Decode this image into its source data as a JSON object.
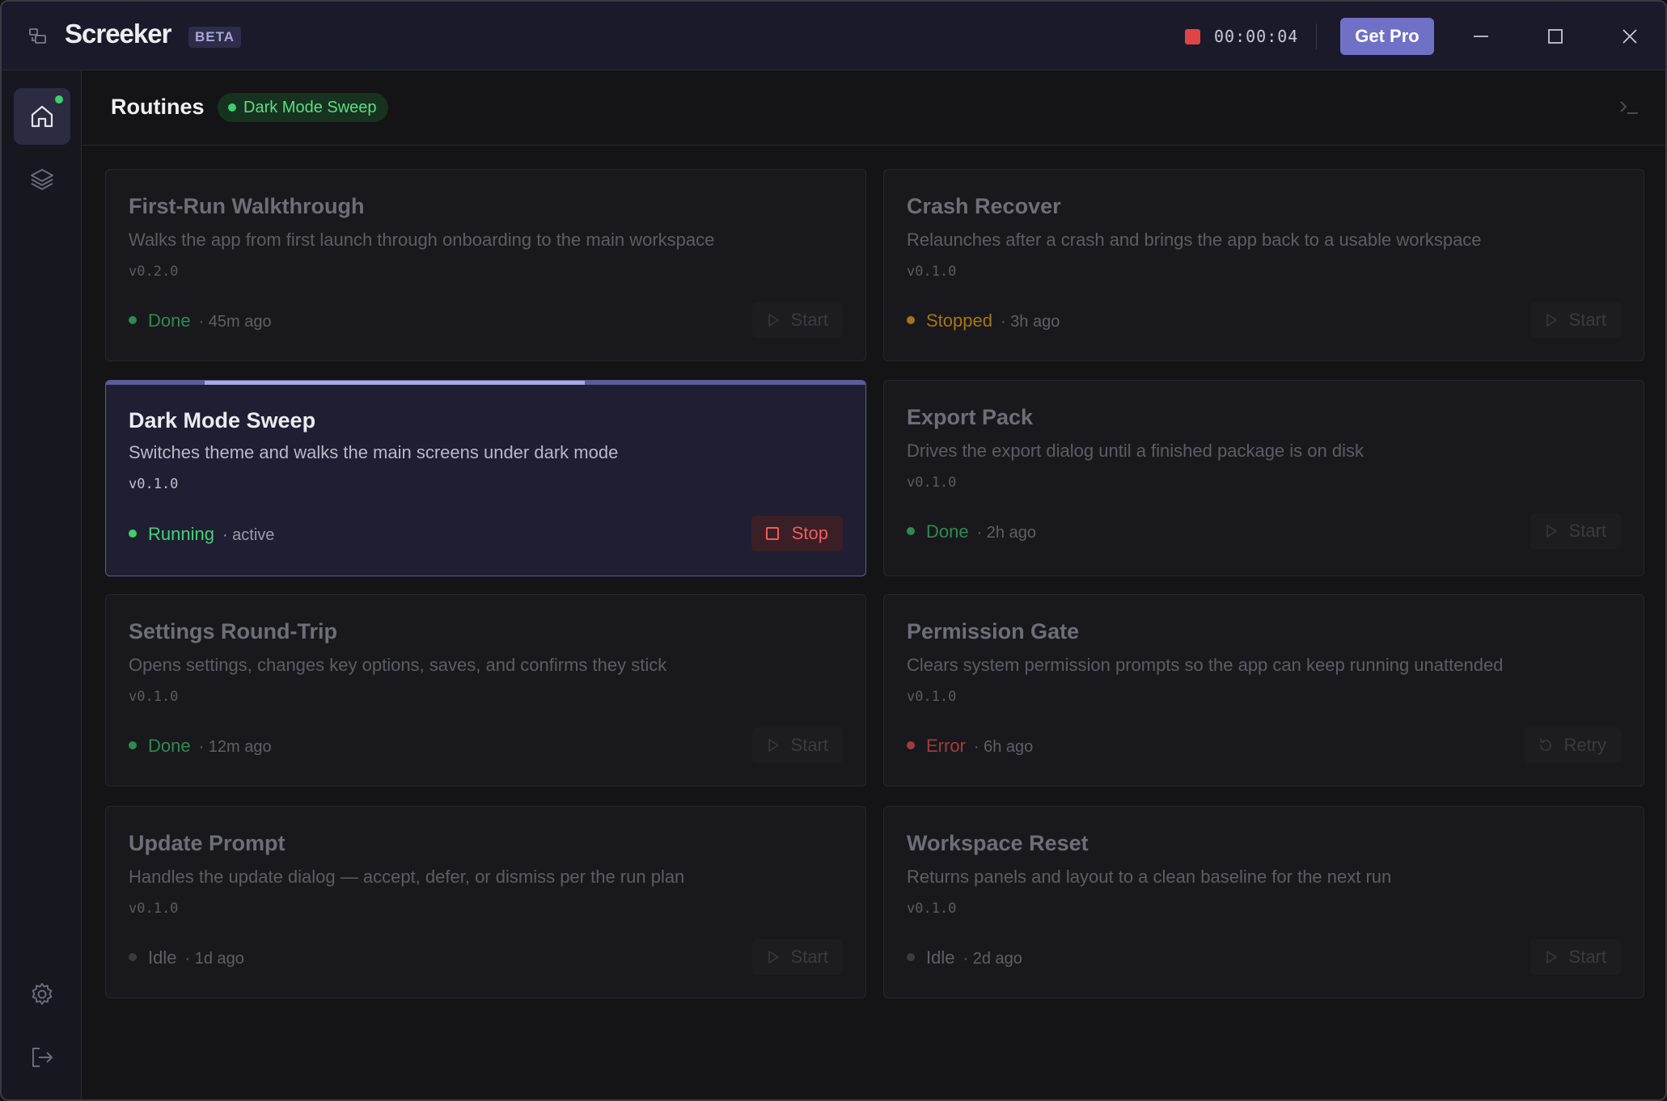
{
  "titlebar": {
    "app_name": "Screeker",
    "badge": "BETA",
    "timer": "00:00:04",
    "get_pro_label": "Get Pro",
    "record_color": "#e04545"
  },
  "sidebar": {
    "items": [
      {
        "name": "home",
        "icon": "home-icon",
        "active": true,
        "notification": true
      },
      {
        "name": "layers",
        "icon": "layers-icon"
      },
      {
        "name": "settings",
        "icon": "gear-icon"
      },
      {
        "name": "logout",
        "icon": "logout-icon"
      }
    ]
  },
  "header": {
    "title": "Routines",
    "active_routine": "Dark Mode Sweep"
  },
  "routines": [
    {
      "title": "First-Run Walkthrough",
      "description": "Walks the app from first launch through onboarding to the main workspace",
      "version": "v0.2.0",
      "status": "Done",
      "time": "· 45m ago",
      "action": "Start"
    },
    {
      "title": "Crash Recover",
      "description": "Relaunches after a crash and brings the app back to a usable workspace",
      "version": "v0.1.0",
      "status": "Stopped",
      "time": "· 3h ago",
      "action": "Start"
    },
    {
      "title": "Dark Mode Sweep",
      "description": "Switches theme and walks the main screens under dark mode",
      "version": "v0.1.0",
      "status": "Running",
      "time": "· active",
      "action": "Stop",
      "progress_start": 0.13,
      "progress_end": 0.63
    },
    {
      "title": "Export Pack",
      "description": "Drives the export dialog until a finished package is on disk",
      "version": "v0.1.0",
      "status": "Done",
      "time": "· 2h ago",
      "action": "Start"
    },
    {
      "title": "Settings Round-Trip",
      "description": "Opens settings, changes key options, saves, and confirms they stick",
      "version": "v0.1.0",
      "status": "Done",
      "time": "· 12m ago",
      "action": "Start"
    },
    {
      "title": "Permission Gate",
      "description": "Clears system permission prompts so the app can keep running unattended",
      "version": "v0.1.0",
      "status": "Error",
      "time": "· 6h ago",
      "action": "Retry"
    },
    {
      "title": "Update Prompt",
      "description": "Handles the update dialog — accept, defer, or dismiss per the run plan",
      "version": "v0.1.0",
      "status": "Idle",
      "time": "· 1d ago",
      "action": "Start"
    },
    {
      "title": "Workspace Reset",
      "description": "Returns panels and layout to a clean baseline for the next run",
      "version": "v0.1.0",
      "status": "Idle",
      "time": "· 2d ago",
      "action": "Start"
    }
  ],
  "colors": {
    "accent": "#7070c6",
    "running": "#3ecf6b",
    "done": "#2f8a4e",
    "stopped": "#a57419",
    "error": "#a33b3b"
  }
}
